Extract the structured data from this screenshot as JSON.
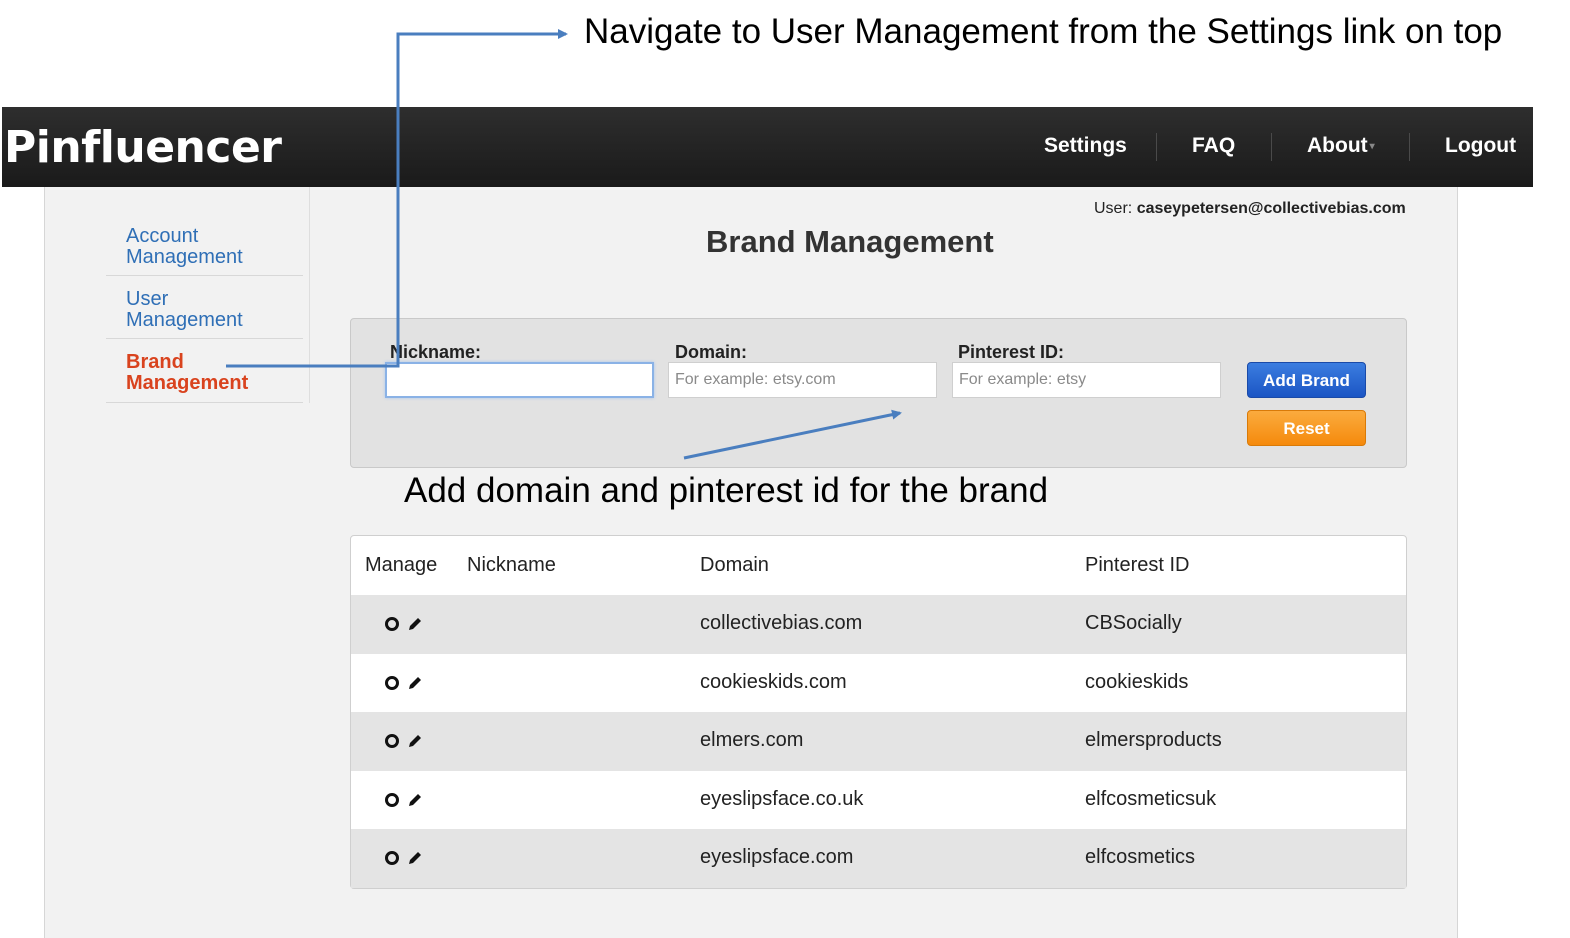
{
  "annotations": {
    "top_note": "Navigate to User Management from the Settings link on top",
    "mid_note": "Add domain and pinterest id for the brand"
  },
  "navbar": {
    "brand": "Pinfluencer",
    "items": [
      {
        "label": "Settings"
      },
      {
        "label": "FAQ"
      },
      {
        "label": "About"
      },
      {
        "label": "Logout"
      }
    ]
  },
  "user": {
    "prefix": "User:",
    "email": "caseypetersen@collectivebias.com"
  },
  "sidebar": {
    "items": [
      {
        "line1": "Account",
        "line2": "Management",
        "active": false
      },
      {
        "line1": "User",
        "line2": "Management",
        "active": false
      },
      {
        "line1": "Brand",
        "line2": "Management",
        "active": true
      }
    ]
  },
  "page": {
    "title": "Brand Management"
  },
  "form": {
    "nickname_label": "Nickname:",
    "nickname_value": "",
    "domain_label": "Domain:",
    "domain_placeholder": "For example: etsy.com",
    "pinterest_label": "Pinterest ID:",
    "pinterest_placeholder": "For example: etsy",
    "add_button": "Add Brand",
    "reset_button": "Reset"
  },
  "table": {
    "headers": [
      "Manage",
      "Nickname",
      "Domain",
      "Pinterest ID"
    ],
    "rows": [
      {
        "nickname": "",
        "domain": "collectivebias.com",
        "pinterest": "CBSocially"
      },
      {
        "nickname": "",
        "domain": "cookieskids.com",
        "pinterest": "cookieskids"
      },
      {
        "nickname": "",
        "domain": "elmers.com",
        "pinterest": "elmersproducts"
      },
      {
        "nickname": "",
        "domain": "eyeslipsface.co.uk",
        "pinterest": "elfcosmeticsuk"
      },
      {
        "nickname": "",
        "domain": "eyeslipsface.com",
        "pinterest": "elfcosmetics"
      }
    ]
  },
  "colors": {
    "link_blue": "#2f6fb6",
    "active_red": "#d9431e",
    "button_blue": "#1b55c4",
    "button_orange": "#f58a0c",
    "arrow_blue": "#4a7ebf"
  }
}
